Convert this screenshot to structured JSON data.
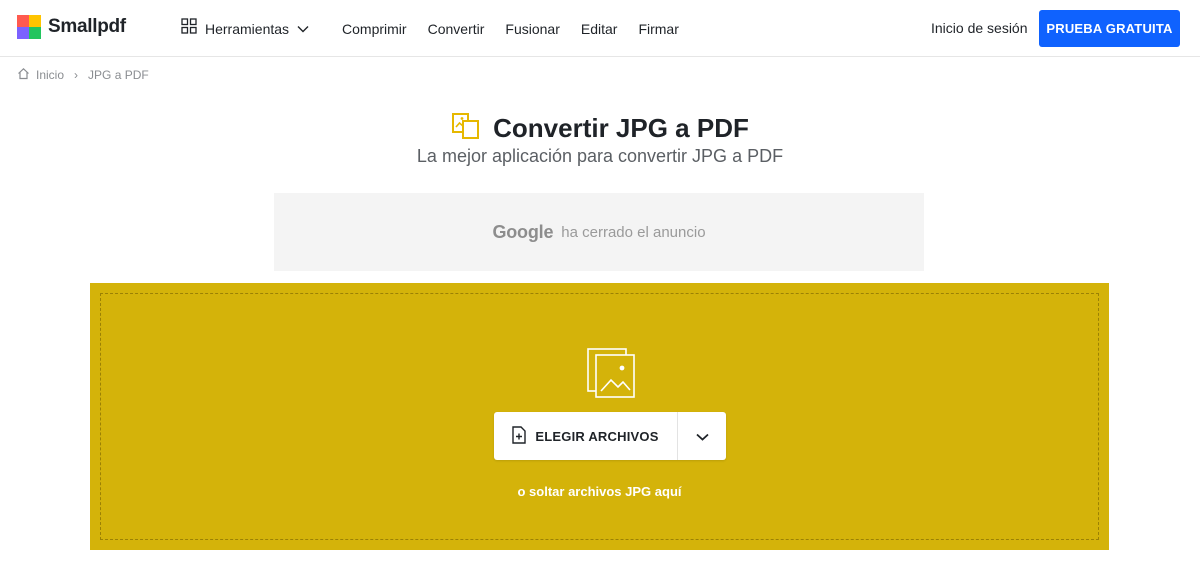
{
  "header": {
    "brand": "Smallpdf",
    "tools_label": "Herramientas",
    "nav": [
      "Comprimir",
      "Convertir",
      "Fusionar",
      "Editar",
      "Firmar"
    ],
    "login": "Inicio de sesión",
    "trial_button": "PRUEBA GRATUITA"
  },
  "breadcrumb": {
    "home": "Inicio",
    "current": "JPG a PDF"
  },
  "hero": {
    "title": "Convertir JPG a PDF",
    "subtitle": "La mejor aplicación para convertir JPG a PDF"
  },
  "ad": {
    "brand": "Google",
    "message": "ha cerrado el anuncio"
  },
  "dropzone": {
    "choose_button": "ELEGIR ARCHIVOS",
    "hint": "o soltar archivos JPG aquí"
  },
  "colors": {
    "accent_blue": "#0f62fe",
    "dropzone_yellow": "#d4b30a",
    "tool_icon": "#e6b800"
  },
  "icons": {
    "logo": "smallpdf-logo-icon",
    "tools": "grid-icon",
    "tools_chevron": "chevron-down-icon",
    "home": "home-icon",
    "title": "jpg-to-pdf-icon",
    "drop": "image-files-icon",
    "choose": "add-file-icon",
    "choose_menu": "chevron-down-icon"
  }
}
